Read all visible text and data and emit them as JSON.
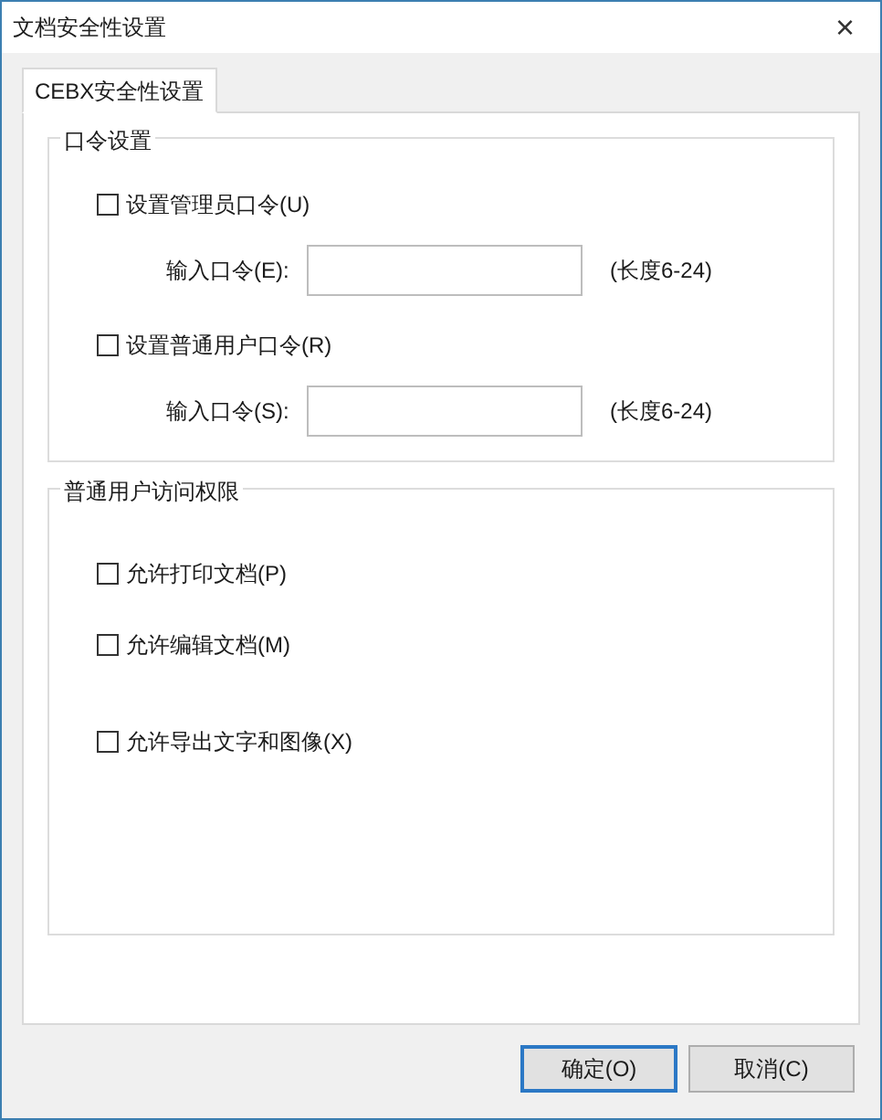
{
  "window": {
    "title": "文档安全性设置",
    "close": "×"
  },
  "tabs": [
    {
      "label": "CEBX安全性设置",
      "selected": true
    }
  ],
  "password_group": {
    "title": "口令设置",
    "items": [
      {
        "checkbox": {
          "label": "设置管理员口令(U)",
          "checked": false
        },
        "field_label": "输入口令(E):",
        "hint": "(长度6-24)"
      },
      {
        "checkbox": {
          "label": "设置普通用户口令(R)",
          "checked": false
        },
        "field_label": "输入口令(S):",
        "hint": "(长度6-24)"
      }
    ]
  },
  "permissions_group": {
    "title": "普通用户访问权限",
    "items": [
      {
        "label": "允许打印文档(P)",
        "checked": false
      },
      {
        "label": "允许编辑文档(M)",
        "checked": false
      },
      {
        "label": "允许导出文字和图像(X)",
        "checked": false
      }
    ]
  },
  "buttons": [
    {
      "label": "确定(O)",
      "default": true
    },
    {
      "label": "取消(C)",
      "default": false
    }
  ]
}
